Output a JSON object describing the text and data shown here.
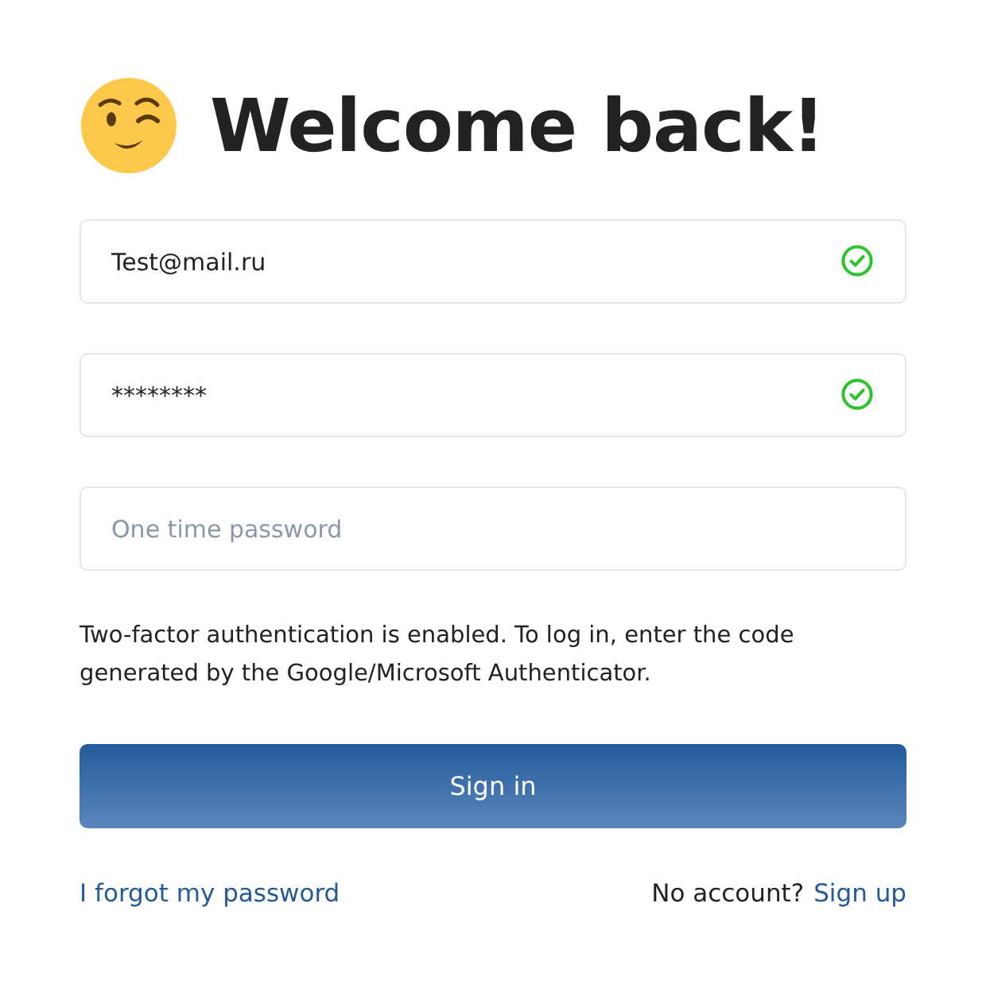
{
  "title": "Welcome back!",
  "fields": [
    {
      "value": "Test@mail.ru",
      "valid": true
    },
    {
      "value": "********",
      "valid": true
    },
    {
      "placeholder": "One time password",
      "valid": false
    }
  ],
  "hint": "Two-factor authentication is enabled. To log in, enter the code generated by the Google/Microsoft Authenticator.",
  "submit": "Sign in",
  "forgot_link": "I forgot my password",
  "signup_prompt": "No account?",
  "signup_link": "Sign up"
}
